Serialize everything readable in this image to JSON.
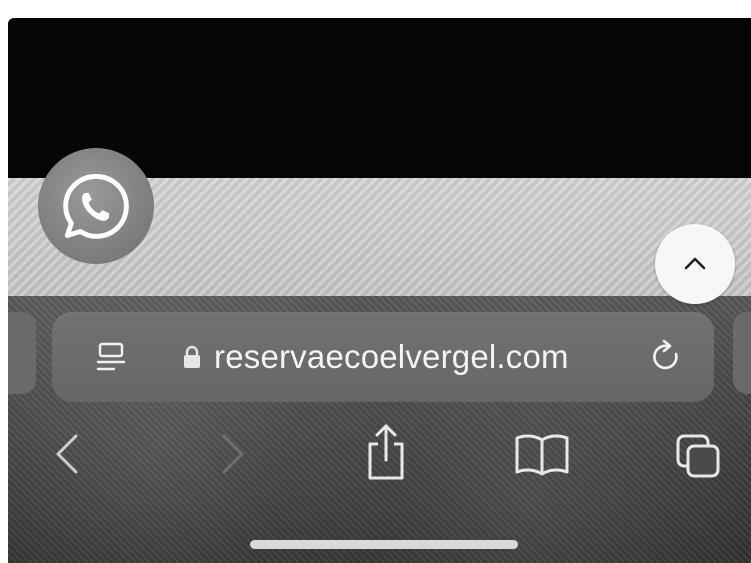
{
  "browser": {
    "url": "reservaecoelvergel.com"
  },
  "floating_buttons": {
    "whatsapp_icon": "whatsapp-icon",
    "scroll_top_icon": "chevron-up-icon"
  },
  "address_bar": {
    "left_icon": "reader-mode-icon",
    "lock_icon": "lock-icon",
    "right_icon": "reload-icon"
  },
  "toolbar": {
    "items": [
      "back-icon",
      "forward-icon",
      "share-icon",
      "bookmarks-icon",
      "tabs-icon"
    ]
  },
  "colors": {
    "chrome_bg": "#4a4a4a",
    "address_bar_bg": "#6c6c6c",
    "url_text": "#f4f4f4",
    "page_strip": "#cbcbcb",
    "top_band": "#050505"
  }
}
